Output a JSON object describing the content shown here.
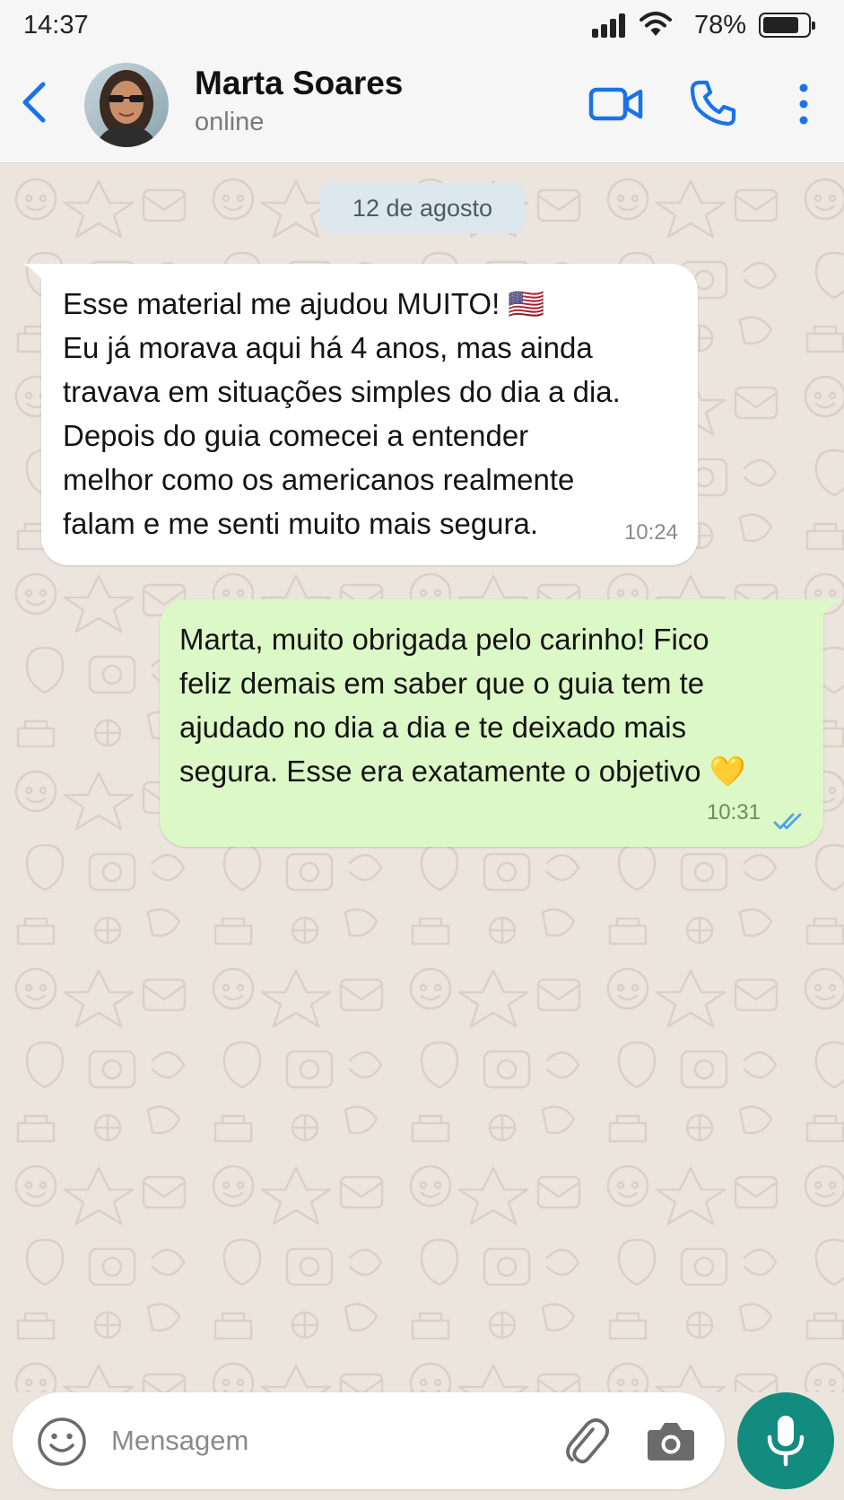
{
  "status_bar": {
    "time": "14:37",
    "battery_percent": "78%",
    "battery_level": 0.78
  },
  "header": {
    "contact_name": "Marta Soares",
    "contact_status": "online",
    "icons": [
      "back-arrow-icon",
      "video-call-icon",
      "phone-icon",
      "more-vertical-icon"
    ]
  },
  "chat": {
    "date_chip": "12 de agosto",
    "messages": [
      {
        "direction": "incoming",
        "text": "Esse material me ajudou MUITO! 🇺🇸\nEu já morava aqui há 4 anos, mas ainda\ntravava em situações simples do dia a dia.\nDepois do guia comecei a entender\nmelhor como os americanos realmente\nfalam e me senti muito mais segura.",
        "time": "10:24"
      },
      {
        "direction": "outgoing",
        "text": "Marta, muito obrigada pelo carinho! Fico\nfeliz demais em saber que o guia tem te\najudado no dia a dia e te deixado mais\nsegura. Esse era exatamente o objetivo 💛",
        "time": "10:31",
        "status": "read"
      }
    ]
  },
  "composer": {
    "placeholder": "Mensagem",
    "value": "",
    "icons": [
      "emoji-icon",
      "paperclip-icon",
      "camera-icon",
      "microphone-icon"
    ]
  },
  "colors": {
    "accent_blue": "#1a73e8",
    "outgoing_bubble": "#dcf8c6",
    "incoming_bubble": "#ffffff",
    "mic_button": "#128c7e",
    "wallpaper": "#ece5dd",
    "read_ticks": "#4fa3e8"
  }
}
